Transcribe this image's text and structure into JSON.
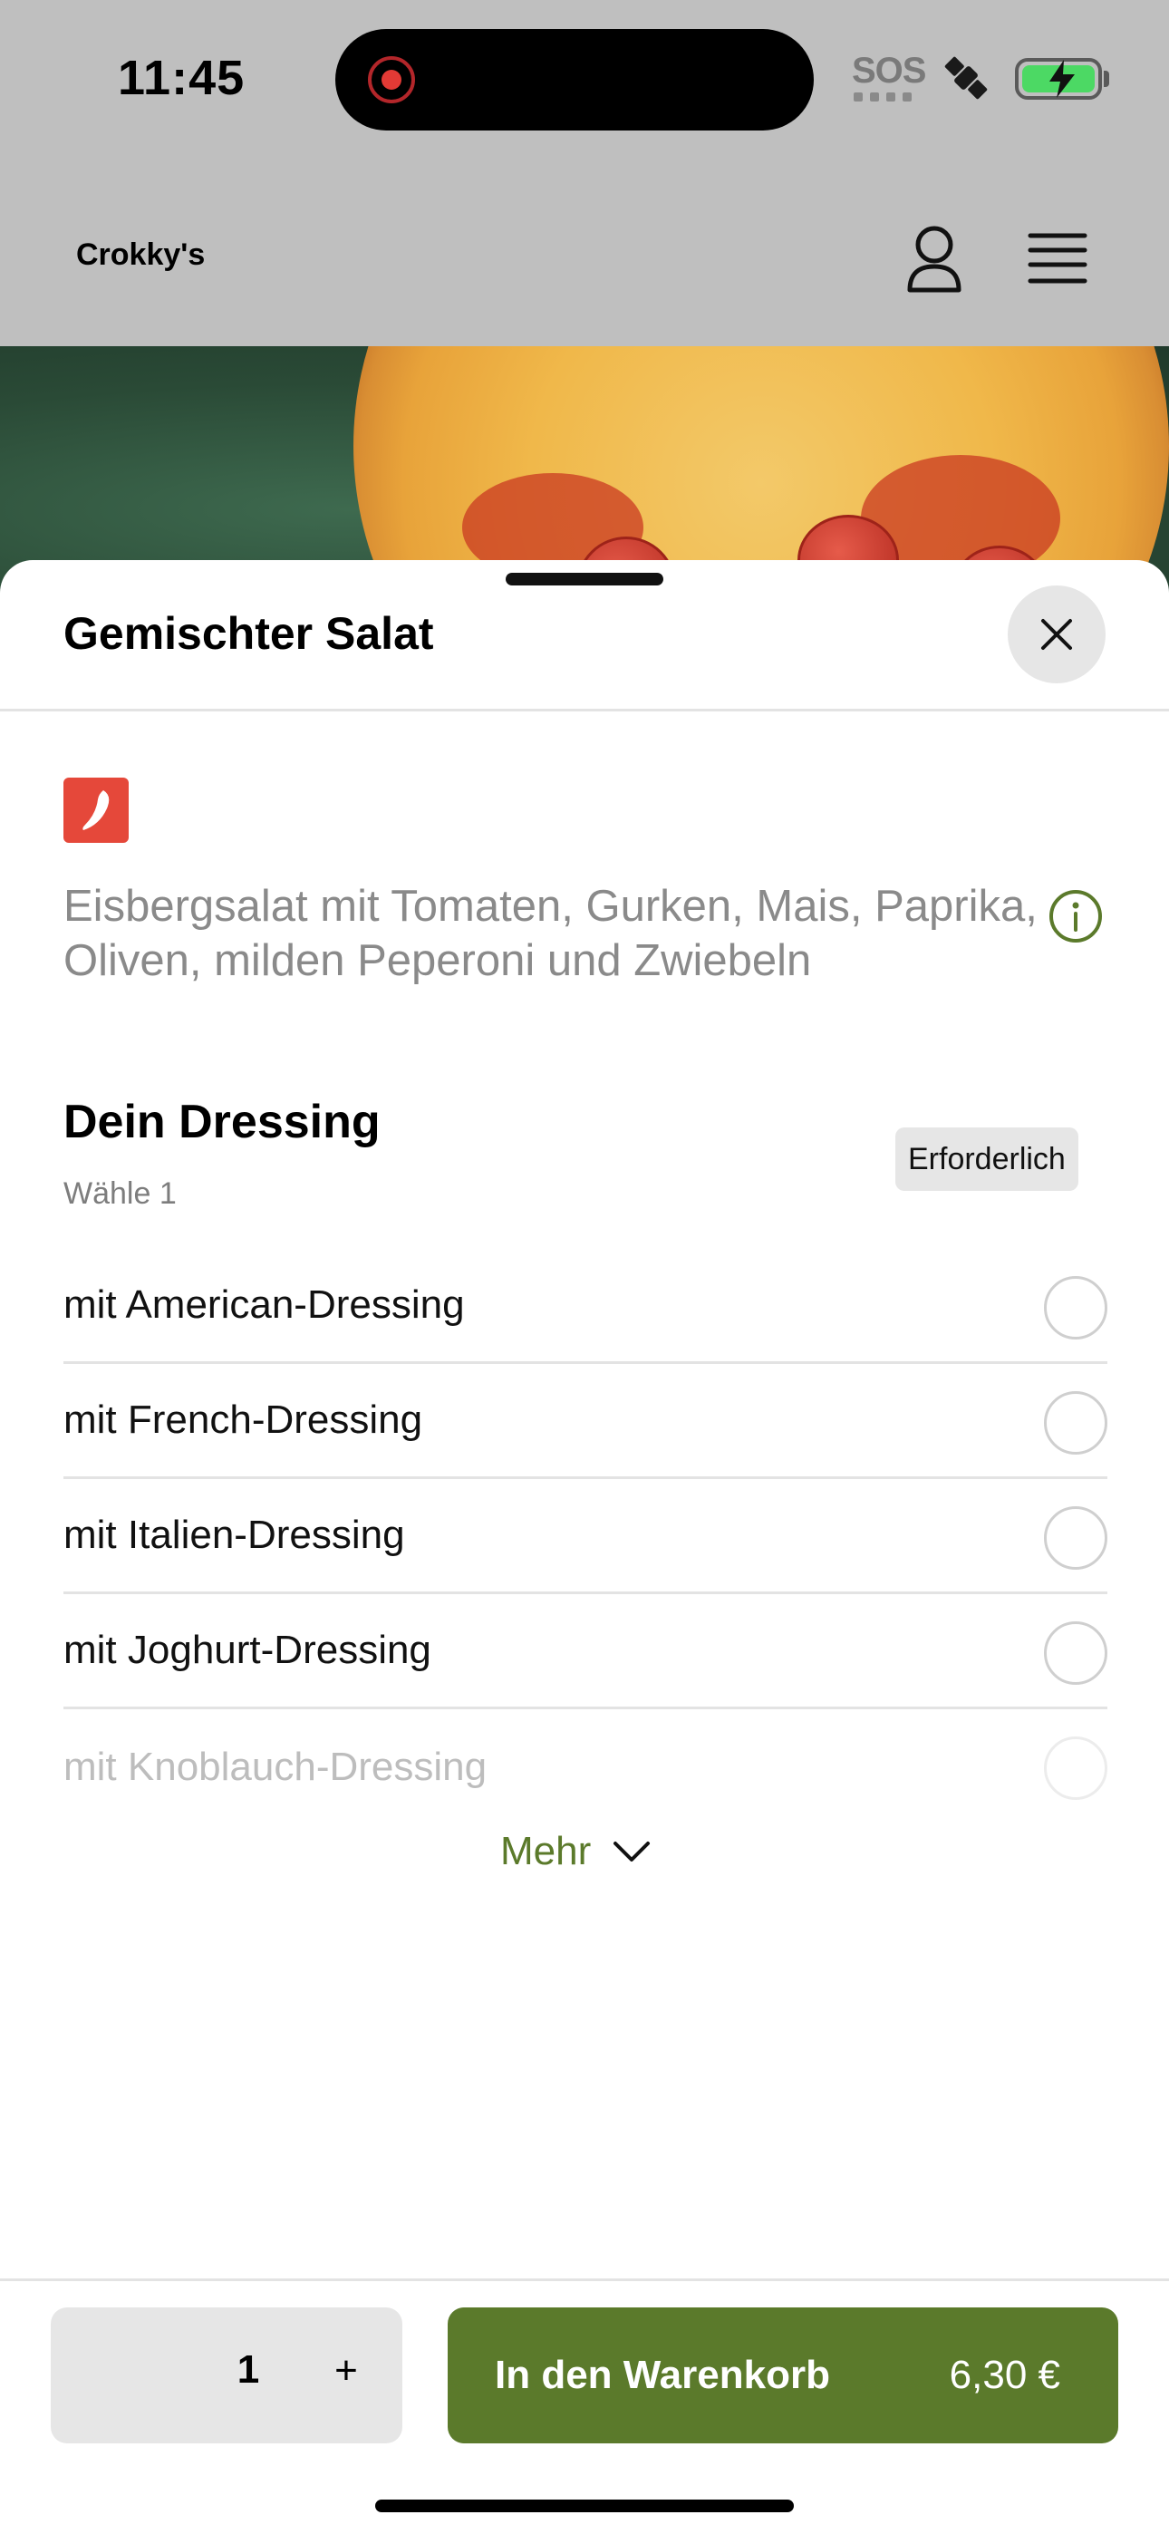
{
  "status_bar": {
    "time": "11:45",
    "sos": "SOS",
    "icons": [
      "screen-recording-icon",
      "satellite-icon",
      "battery-charging-icon"
    ]
  },
  "app": {
    "brand": "Crokky's",
    "icons": [
      "profile-icon",
      "menu-icon"
    ]
  },
  "sheet": {
    "title": "Gemischter Salat",
    "description": "Eisbergsalat mit Tomaten, Gurken, Mais, Paprika, Oliven, milden Peperoni und Zwiebeln",
    "badge_icon": "chili-icon",
    "section": {
      "title": "Dein Dressing",
      "subtitle": "Wähle 1",
      "required_label": "Erforderlich",
      "options": [
        {
          "label": "mit American-Dressing",
          "selected": false
        },
        {
          "label": "mit French-Dressing",
          "selected": false
        },
        {
          "label": "mit Italien-Dressing",
          "selected": false
        },
        {
          "label": "mit Joghurt-Dressing",
          "selected": false
        },
        {
          "label": "mit Knoblauch-Dressing",
          "selected": false
        }
      ],
      "more_label": "Mehr"
    }
  },
  "footer": {
    "quantity": "1",
    "plus": "+",
    "cart_label": "In den Warenkorb",
    "price": "6,30 €"
  },
  "colors": {
    "accent_green": "#5b7a2b",
    "chili_red": "#e5483a",
    "dim_overlay": "#bfbfbf"
  }
}
